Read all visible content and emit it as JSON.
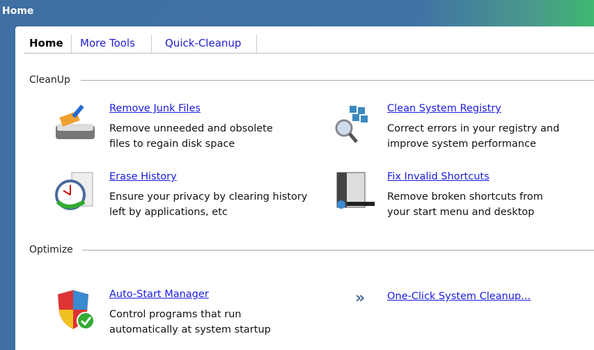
{
  "window": {
    "title": "Home"
  },
  "tabs": [
    {
      "label": "Home"
    },
    {
      "label": "More Tools"
    },
    {
      "label": "Quick-Cleanup"
    }
  ],
  "sections": {
    "cleanup": "CleanUp",
    "optimize": "Optimize"
  },
  "items": [
    {
      "title": "Remove Junk Files",
      "desc1": "Remove unneeded and obsolete",
      "desc2": "files to regain disk space"
    },
    {
      "title": "Clean System Registry",
      "desc1": "Correct errors in your registry and",
      "desc2": "improve system performance"
    },
    {
      "title": "Erase History",
      "desc1": "Ensure your privacy by clearing history",
      "desc2": "left by applications, etc"
    },
    {
      "title": "Fix Invalid Shortcuts",
      "desc1": "Remove broken shortcuts from",
      "desc2": "your start menu and desktop"
    },
    {
      "title": "Auto-Start Manager",
      "desc1": "Control programs that run",
      "desc2": "automatically at system startup"
    }
  ],
  "one_click": {
    "label": "One-Click System Cleanup...",
    "icon": "double-chevron-right"
  }
}
